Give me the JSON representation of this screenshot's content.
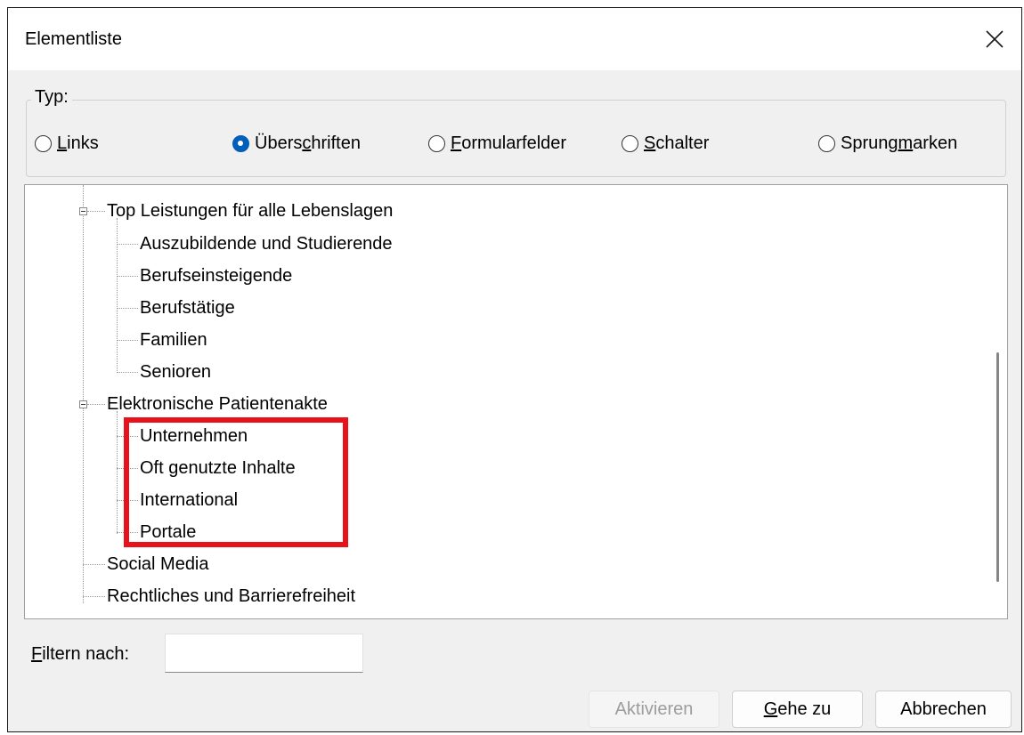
{
  "window": {
    "title": "Elementliste",
    "close_icon": "close-icon"
  },
  "type_group": {
    "legend": "Typ:",
    "options": [
      {
        "pre": "",
        "u": "L",
        "post": "inks",
        "checked": false
      },
      {
        "pre": "Übers",
        "u": "c",
        "post": "hriften",
        "checked": true
      },
      {
        "pre": "",
        "u": "F",
        "post": "ormularfelder",
        "checked": false
      },
      {
        "pre": "",
        "u": "S",
        "post": "chalter",
        "checked": false
      },
      {
        "pre": "Sprung",
        "u": "m",
        "post": "arken",
        "checked": false
      }
    ]
  },
  "tree": {
    "items": [
      "Top Leistungen für alle Lebenslagen",
      "Auszubildende und Studierende",
      "Berufseinsteigende",
      "Berufstätige",
      "Familien",
      "Senioren",
      "Elektronische Patientenakte",
      "Unternehmen",
      "Oft genutzte Inhalte",
      "International",
      "Portale",
      "Social Media",
      "Rechtliches und Barrierefreiheit"
    ],
    "highlight_color": "#e8121c"
  },
  "filter": {
    "u": "F",
    "rest": "iltern nach:",
    "value": ""
  },
  "buttons": {
    "activate": "Aktivieren",
    "goto_u": "G",
    "goto_rest": "ehe zu",
    "cancel": "Abbrechen"
  },
  "colors": {
    "radio_accent": "#005fb8",
    "dialog_bg": "#f0f0f0"
  }
}
